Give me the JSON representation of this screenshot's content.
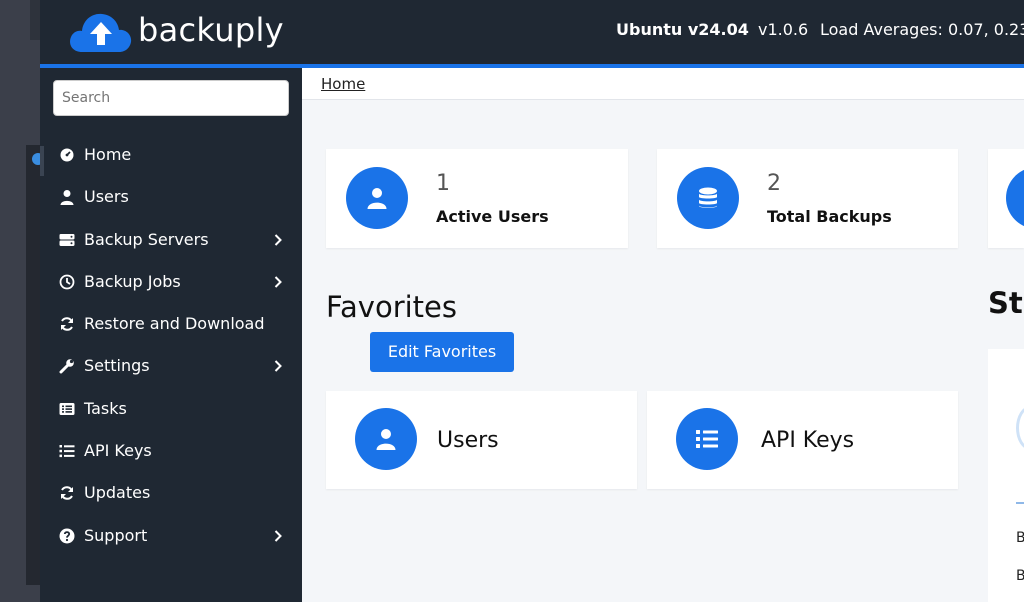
{
  "header": {
    "brand": "backuply",
    "os": "Ubuntu v24.04",
    "version": "v1.0.6",
    "load": "Load Averages: 0.07, 0.23"
  },
  "sidebar": {
    "search_placeholder": "Search",
    "items": [
      {
        "label": "Home",
        "icon": "gauge-icon",
        "chevron": false
      },
      {
        "label": "Users",
        "icon": "user-icon",
        "chevron": false
      },
      {
        "label": "Backup Servers",
        "icon": "server-icon",
        "chevron": true
      },
      {
        "label": "Backup Jobs",
        "icon": "clock-icon",
        "chevron": true
      },
      {
        "label": "Restore and Download",
        "icon": "sync-icon",
        "chevron": false
      },
      {
        "label": "Settings",
        "icon": "wrench-icon",
        "chevron": true
      },
      {
        "label": "Tasks",
        "icon": "list-alt-icon",
        "chevron": false
      },
      {
        "label": "API Keys",
        "icon": "list-icon",
        "chevron": false
      },
      {
        "label": "Updates",
        "icon": "sync-icon",
        "chevron": false
      },
      {
        "label": "Support",
        "icon": "question-circle-icon",
        "chevron": true
      }
    ]
  },
  "main": {
    "breadcrumb": "Home",
    "stats": [
      {
        "value": "1",
        "label": "Active Users",
        "icon": "user-icon"
      },
      {
        "value": "2",
        "label": "Total Backups",
        "icon": "database-icon"
      }
    ],
    "favorites_title": "Favorites",
    "edit_favorites": "Edit Favorites",
    "favorites": [
      {
        "label": "Users",
        "icon": "user-icon"
      },
      {
        "label": "API Keys",
        "icon": "list-icon"
      }
    ],
    "stats_title_partial": "St",
    "right_chars": [
      "B",
      "B"
    ]
  },
  "colors": {
    "accent": "#1a73e8",
    "sidebar_bg": "#1f2833",
    "content_bg": "#f4f6f9"
  }
}
